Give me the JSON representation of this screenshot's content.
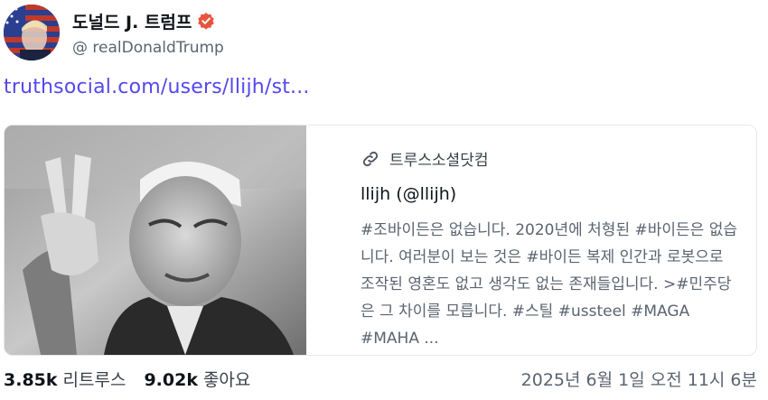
{
  "author": {
    "display_name": "도널드 J. 트럼프",
    "handle": "@ realDonaldTrump",
    "avatar_icon": "avatar-flag-portrait",
    "verified_icon": "verified-badge-icon",
    "verified_color": "#e8553e"
  },
  "post": {
    "link_text": "truthsocial.com/users/llijh/st...",
    "link_color": "#5448ee"
  },
  "card": {
    "image_icon": "portrait-peace-sign-photo",
    "provider_icon": "link-icon",
    "provider": "트루스소셜닷컴",
    "title": "llijh (@llijh)",
    "description": "#조바이든은 없습니다. 2020년에 처형된 #바이든은 없습니다. 여러분이 보는 것은 #바이든 복제 인간과 로봇으로 조작된 영혼도 없고 생각도 없는 존재들입니다. >#민주당은 그 차이를 모릅니다. #스틸 #ussteel #MAGA #MAHA ..."
  },
  "stats": {
    "retruths_count": "3.85k",
    "retruths_label": "리트루스",
    "likes_count": "9.02k",
    "likes_label": "좋아요"
  },
  "timestamp": "2025년 6월 1일 오전 11시 6분"
}
